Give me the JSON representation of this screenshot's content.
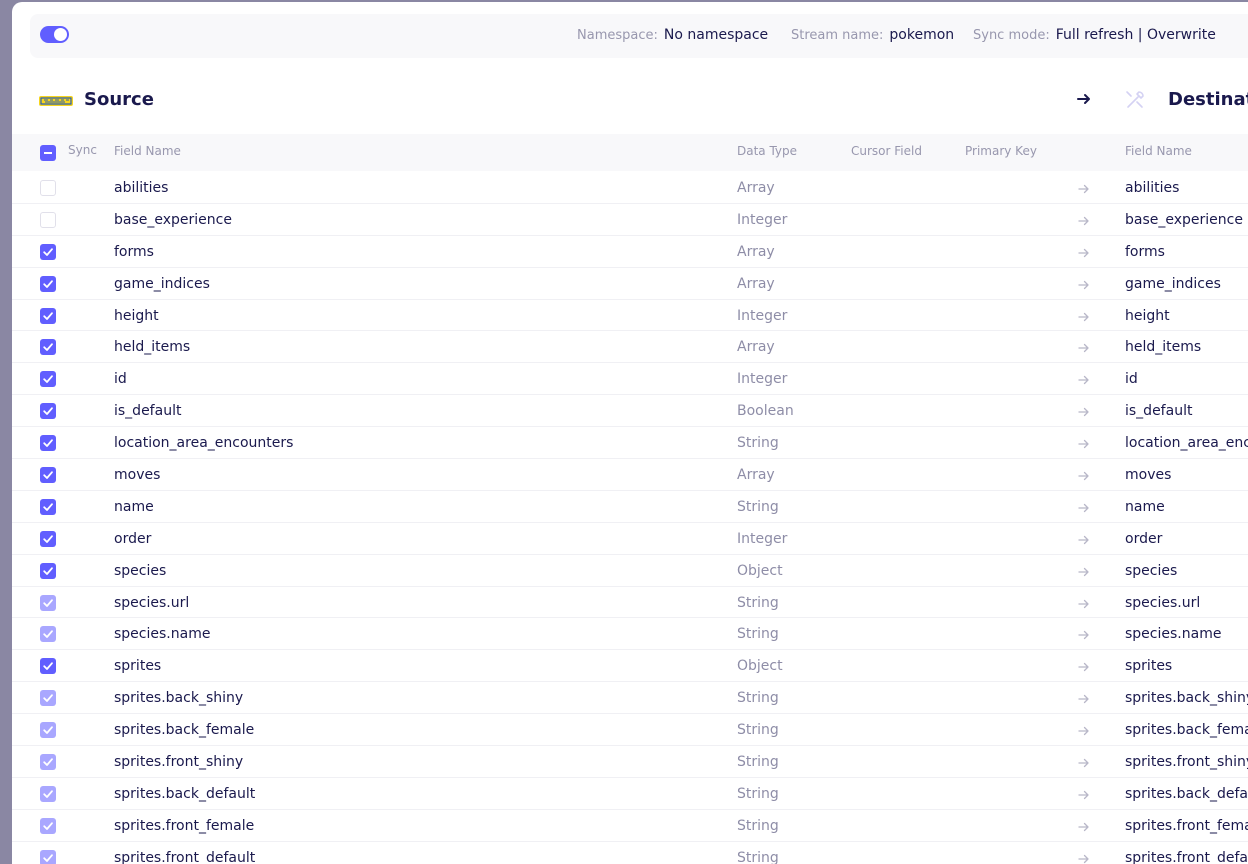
{
  "header": {
    "namespace_label": "Namespace:",
    "namespace_value": "No namespace",
    "stream_label": "Stream name:",
    "stream_value": "pokemon",
    "syncmode_label": "Sync mode:",
    "syncmode_value": "Full refresh | Overwrite",
    "toggle_on": true
  },
  "source": {
    "title": "Source",
    "logo_text": "Pokémon"
  },
  "destination": {
    "title": "Destination"
  },
  "columns": {
    "sync": "Sync",
    "field_name": "Field Name",
    "data_type": "Data Type",
    "cursor_field": "Cursor Field",
    "primary_key": "Primary Key",
    "dest_field_name": "Field Name"
  },
  "colors": {
    "accent": "#615eff",
    "accent_light": "#a9a7ff",
    "text": "#1a194d",
    "muted": "#9897ae"
  },
  "rows": [
    {
      "name": "abilities",
      "type": "Array",
      "dest": "abilities",
      "state": "off"
    },
    {
      "name": "base_experience",
      "type": "Integer",
      "dest": "base_experience",
      "state": "off"
    },
    {
      "name": "forms",
      "type": "Array",
      "dest": "forms",
      "state": "on"
    },
    {
      "name": "game_indices",
      "type": "Array",
      "dest": "game_indices",
      "state": "on"
    },
    {
      "name": "height",
      "type": "Integer",
      "dest": "height",
      "state": "on"
    },
    {
      "name": "held_items",
      "type": "Array",
      "dest": "held_items",
      "state": "on"
    },
    {
      "name": "id",
      "type": "Integer",
      "dest": "id",
      "state": "on"
    },
    {
      "name": "is_default",
      "type": "Boolean",
      "dest": "is_default",
      "state": "on"
    },
    {
      "name": "location_area_encounters",
      "type": "String",
      "dest": "location_area_encounters",
      "state": "on"
    },
    {
      "name": "moves",
      "type": "Array",
      "dest": "moves",
      "state": "on"
    },
    {
      "name": "name",
      "type": "String",
      "dest": "name",
      "state": "on"
    },
    {
      "name": "order",
      "type": "Integer",
      "dest": "order",
      "state": "on"
    },
    {
      "name": "species",
      "type": "Object",
      "dest": "species",
      "state": "on"
    },
    {
      "name": "species.url",
      "type": "String",
      "dest": "species.url",
      "state": "partial"
    },
    {
      "name": "species.name",
      "type": "String",
      "dest": "species.name",
      "state": "partial"
    },
    {
      "name": "sprites",
      "type": "Object",
      "dest": "sprites",
      "state": "on"
    },
    {
      "name": "sprites.back_shiny",
      "type": "String",
      "dest": "sprites.back_shiny",
      "state": "partial"
    },
    {
      "name": "sprites.back_female",
      "type": "String",
      "dest": "sprites.back_female",
      "state": "partial"
    },
    {
      "name": "sprites.front_shiny",
      "type": "String",
      "dest": "sprites.front_shiny",
      "state": "partial"
    },
    {
      "name": "sprites.back_default",
      "type": "String",
      "dest": "sprites.back_default",
      "state": "partial"
    },
    {
      "name": "sprites.front_female",
      "type": "String",
      "dest": "sprites.front_female",
      "state": "partial"
    },
    {
      "name": "sprites.front_default",
      "type": "String",
      "dest": "sprites.front_default",
      "state": "partial"
    }
  ]
}
